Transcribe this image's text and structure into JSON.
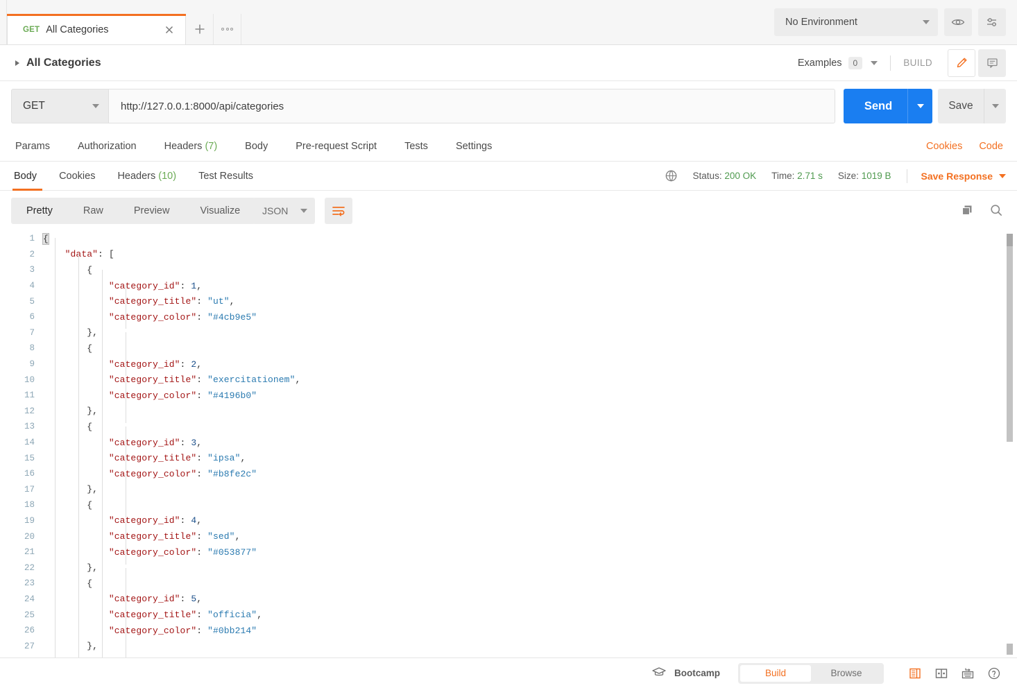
{
  "tab": {
    "method": "GET",
    "title": "All Categories",
    "close_icon": "close-icon",
    "add_icon": "add-tab-icon",
    "more_icon": "more-options-icon"
  },
  "environment": {
    "selected": "No Environment",
    "eye_icon": "eye-icon",
    "settings_icon": "sliders-icon"
  },
  "breadcrumb": {
    "label": "All Categories",
    "examples_label": "Examples",
    "examples_count": "0",
    "build_label": "BUILD",
    "edit_icon": "pencil-icon",
    "comment_icon": "comment-icon"
  },
  "request": {
    "method": "GET",
    "url": "http://127.0.0.1:8000/api/categories",
    "send_label": "Send",
    "save_label": "Save",
    "tabs": [
      {
        "label": "Params",
        "count": ""
      },
      {
        "label": "Authorization",
        "count": ""
      },
      {
        "label": "Headers",
        "count": "(7)"
      },
      {
        "label": "Body",
        "count": ""
      },
      {
        "label": "Pre-request Script",
        "count": ""
      },
      {
        "label": "Tests",
        "count": ""
      },
      {
        "label": "Settings",
        "count": ""
      }
    ],
    "cookies_link": "Cookies",
    "code_link": "Code"
  },
  "response": {
    "tabs": [
      {
        "label": "Body",
        "count": ""
      },
      {
        "label": "Cookies",
        "count": ""
      },
      {
        "label": "Headers",
        "count": "(10)"
      },
      {
        "label": "Test Results",
        "count": ""
      }
    ],
    "status_label": "Status:",
    "status_value": "200 OK",
    "time_label": "Time:",
    "time_value": "2.71 s",
    "size_label": "Size:",
    "size_value": "1019 B",
    "save_response": "Save Response",
    "globe_icon": "globe-icon"
  },
  "format": {
    "views": [
      "Pretty",
      "Raw",
      "Preview",
      "Visualize"
    ],
    "active_view": "Pretty",
    "language": "JSON",
    "wrap_icon": "wrap-text-icon",
    "copy_icon": "copy-icon",
    "search_icon": "search-icon"
  },
  "body_lines": [
    {
      "n": 1,
      "indent": 0,
      "tokens": [
        {
          "t": "{",
          "c": "p",
          "hl": true
        }
      ]
    },
    {
      "n": 2,
      "indent": 1,
      "tokens": [
        {
          "t": "\"data\"",
          "c": "k"
        },
        {
          "t": ": ",
          "c": "p"
        },
        {
          "t": "[",
          "c": "p"
        }
      ]
    },
    {
      "n": 3,
      "indent": 2,
      "tokens": [
        {
          "t": "{",
          "c": "p"
        }
      ]
    },
    {
      "n": 4,
      "indent": 3,
      "tokens": [
        {
          "t": "\"category_id\"",
          "c": "k"
        },
        {
          "t": ": ",
          "c": "p"
        },
        {
          "t": "1",
          "c": "n"
        },
        {
          "t": ",",
          "c": "p"
        }
      ]
    },
    {
      "n": 5,
      "indent": 3,
      "tokens": [
        {
          "t": "\"category_title\"",
          "c": "k"
        },
        {
          "t": ": ",
          "c": "p"
        },
        {
          "t": "\"ut\"",
          "c": "s"
        },
        {
          "t": ",",
          "c": "p"
        }
      ]
    },
    {
      "n": 6,
      "indent": 3,
      "tokens": [
        {
          "t": "\"category_color\"",
          "c": "k"
        },
        {
          "t": ": ",
          "c": "p"
        },
        {
          "t": "\"#4cb9e5\"",
          "c": "s"
        }
      ]
    },
    {
      "n": 7,
      "indent": 2,
      "tokens": [
        {
          "t": "}",
          "c": "p"
        },
        {
          "t": ",",
          "c": "p"
        }
      ]
    },
    {
      "n": 8,
      "indent": 2,
      "tokens": [
        {
          "t": "{",
          "c": "p"
        }
      ]
    },
    {
      "n": 9,
      "indent": 3,
      "tokens": [
        {
          "t": "\"category_id\"",
          "c": "k"
        },
        {
          "t": ": ",
          "c": "p"
        },
        {
          "t": "2",
          "c": "n"
        },
        {
          "t": ",",
          "c": "p"
        }
      ]
    },
    {
      "n": 10,
      "indent": 3,
      "tokens": [
        {
          "t": "\"category_title\"",
          "c": "k"
        },
        {
          "t": ": ",
          "c": "p"
        },
        {
          "t": "\"exercitationem\"",
          "c": "s"
        },
        {
          "t": ",",
          "c": "p"
        }
      ]
    },
    {
      "n": 11,
      "indent": 3,
      "tokens": [
        {
          "t": "\"category_color\"",
          "c": "k"
        },
        {
          "t": ": ",
          "c": "p"
        },
        {
          "t": "\"#4196b0\"",
          "c": "s"
        }
      ]
    },
    {
      "n": 12,
      "indent": 2,
      "tokens": [
        {
          "t": "}",
          "c": "p"
        },
        {
          "t": ",",
          "c": "p"
        }
      ]
    },
    {
      "n": 13,
      "indent": 2,
      "tokens": [
        {
          "t": "{",
          "c": "p"
        }
      ]
    },
    {
      "n": 14,
      "indent": 3,
      "tokens": [
        {
          "t": "\"category_id\"",
          "c": "k"
        },
        {
          "t": ": ",
          "c": "p"
        },
        {
          "t": "3",
          "c": "n"
        },
        {
          "t": ",",
          "c": "p"
        }
      ]
    },
    {
      "n": 15,
      "indent": 3,
      "tokens": [
        {
          "t": "\"category_title\"",
          "c": "k"
        },
        {
          "t": ": ",
          "c": "p"
        },
        {
          "t": "\"ipsa\"",
          "c": "s"
        },
        {
          "t": ",",
          "c": "p"
        }
      ]
    },
    {
      "n": 16,
      "indent": 3,
      "tokens": [
        {
          "t": "\"category_color\"",
          "c": "k"
        },
        {
          "t": ": ",
          "c": "p"
        },
        {
          "t": "\"#b8fe2c\"",
          "c": "s"
        }
      ]
    },
    {
      "n": 17,
      "indent": 2,
      "tokens": [
        {
          "t": "}",
          "c": "p"
        },
        {
          "t": ",",
          "c": "p"
        }
      ]
    },
    {
      "n": 18,
      "indent": 2,
      "tokens": [
        {
          "t": "{",
          "c": "p"
        }
      ]
    },
    {
      "n": 19,
      "indent": 3,
      "tokens": [
        {
          "t": "\"category_id\"",
          "c": "k"
        },
        {
          "t": ": ",
          "c": "p"
        },
        {
          "t": "4",
          "c": "n"
        },
        {
          "t": ",",
          "c": "p"
        }
      ]
    },
    {
      "n": 20,
      "indent": 3,
      "tokens": [
        {
          "t": "\"category_title\"",
          "c": "k"
        },
        {
          "t": ": ",
          "c": "p"
        },
        {
          "t": "\"sed\"",
          "c": "s"
        },
        {
          "t": ",",
          "c": "p"
        }
      ]
    },
    {
      "n": 21,
      "indent": 3,
      "tokens": [
        {
          "t": "\"category_color\"",
          "c": "k"
        },
        {
          "t": ": ",
          "c": "p"
        },
        {
          "t": "\"#053877\"",
          "c": "s"
        }
      ]
    },
    {
      "n": 22,
      "indent": 2,
      "tokens": [
        {
          "t": "}",
          "c": "p"
        },
        {
          "t": ",",
          "c": "p"
        }
      ]
    },
    {
      "n": 23,
      "indent": 2,
      "tokens": [
        {
          "t": "{",
          "c": "p"
        }
      ]
    },
    {
      "n": 24,
      "indent": 3,
      "tokens": [
        {
          "t": "\"category_id\"",
          "c": "k"
        },
        {
          "t": ": ",
          "c": "p"
        },
        {
          "t": "5",
          "c": "n"
        },
        {
          "t": ",",
          "c": "p"
        }
      ]
    },
    {
      "n": 25,
      "indent": 3,
      "tokens": [
        {
          "t": "\"category_title\"",
          "c": "k"
        },
        {
          "t": ": ",
          "c": "p"
        },
        {
          "t": "\"officia\"",
          "c": "s"
        },
        {
          "t": ",",
          "c": "p"
        }
      ]
    },
    {
      "n": 26,
      "indent": 3,
      "tokens": [
        {
          "t": "\"category_color\"",
          "c": "k"
        },
        {
          "t": ": ",
          "c": "p"
        },
        {
          "t": "\"#0bb214\"",
          "c": "s"
        }
      ]
    },
    {
      "n": 27,
      "indent": 2,
      "tokens": [
        {
          "t": "}",
          "c": "p"
        },
        {
          "t": ",",
          "c": "p"
        }
      ]
    }
  ],
  "footer": {
    "bootcamp_label": "Bootcamp",
    "bootcamp_icon": "graduation-cap-icon",
    "build_label": "Build",
    "browse_label": "Browse",
    "icons": [
      "two-pane-icon",
      "split-pane-icon",
      "keyboard-shortcuts-icon",
      "help-icon"
    ]
  },
  "colors": {
    "accent": "#f37021",
    "send_blue": "#1a7ef1",
    "green": "#6bab55",
    "status_green": "#4f9a4f"
  }
}
